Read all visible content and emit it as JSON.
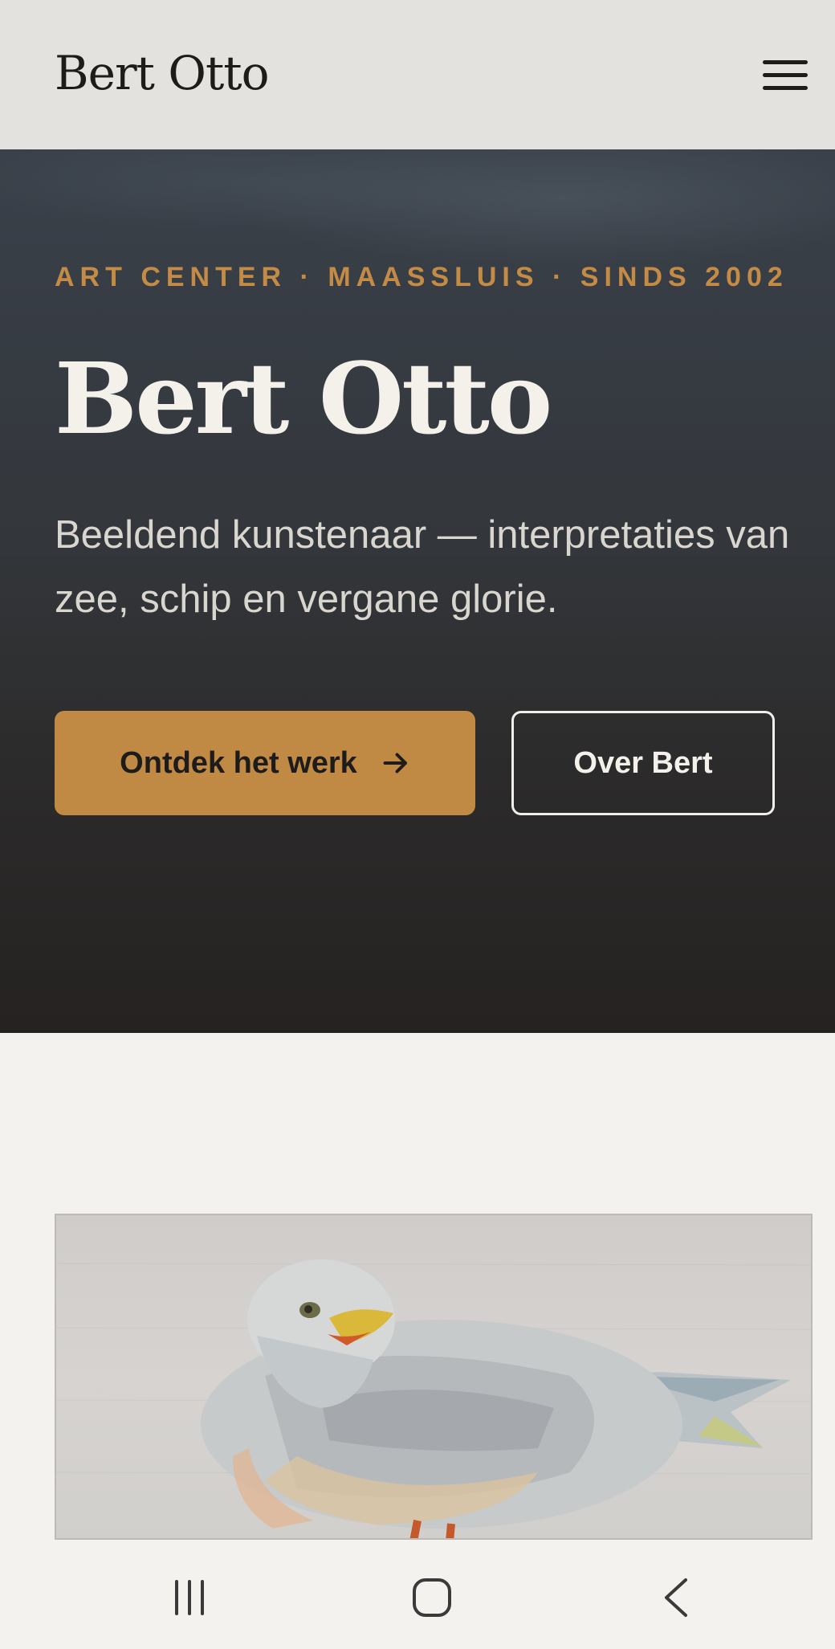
{
  "header": {
    "logo_text": "Bert Otto",
    "menu_icon": "hamburger-menu-icon"
  },
  "hero": {
    "eyebrow": "ART CENTER · MAASSLUIS · SINDS 2002",
    "title": "Bert Otto",
    "subtitle": "Beeldend kunstenaar — interpretaties van zee, schip en vergane glorie.",
    "primary_button_label": "Ontdek het werk",
    "primary_button_icon": "arrow-right-icon",
    "secondary_button_label": "Over Bert"
  },
  "artwork": {
    "subject": "seagull painting"
  },
  "system_nav": {
    "recent_icon": "recent-apps-icon",
    "home_icon": "home-icon",
    "back_icon": "back-icon"
  },
  "colors": {
    "accent": "#c08a44",
    "header_bg": "#e3e2de",
    "page_bg": "#f3f2ee",
    "hero_text": "#f4f1ea"
  }
}
